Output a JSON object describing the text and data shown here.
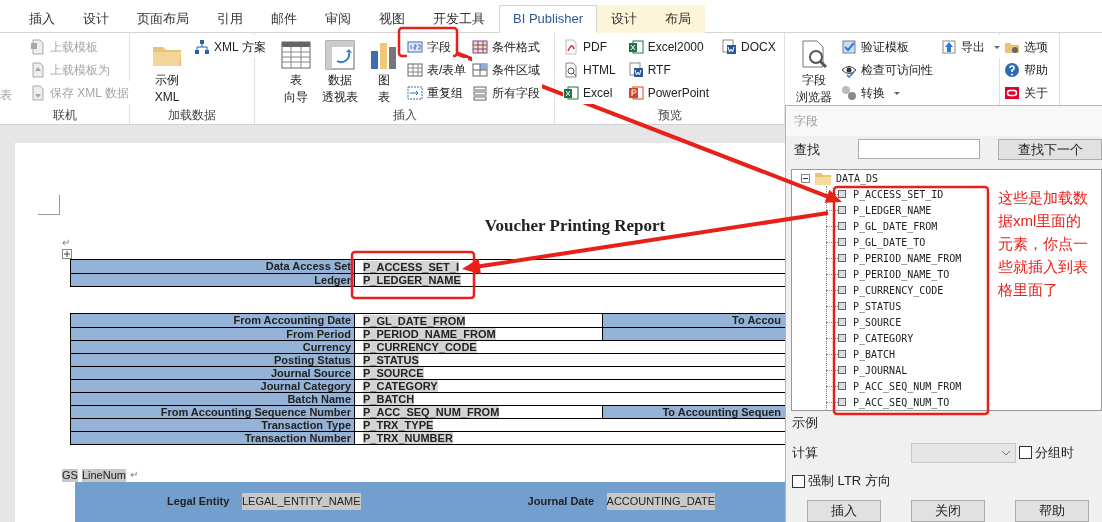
{
  "tabs": [
    {
      "label": "插入",
      "selected": false,
      "kind": "normal"
    },
    {
      "label": "设计",
      "selected": false,
      "kind": "normal"
    },
    {
      "label": "页面布局",
      "selected": false,
      "kind": "normal"
    },
    {
      "label": "引用",
      "selected": false,
      "kind": "normal"
    },
    {
      "label": "邮件",
      "selected": false,
      "kind": "normal"
    },
    {
      "label": "审阅",
      "selected": false,
      "kind": "normal"
    },
    {
      "label": "视图",
      "selected": false,
      "kind": "normal"
    },
    {
      "label": "开发工具",
      "selected": false,
      "kind": "normal"
    },
    {
      "label": "BI Publisher",
      "selected": true,
      "kind": "normal"
    },
    {
      "label": "设计",
      "selected": false,
      "kind": "contextual"
    },
    {
      "label": "布局",
      "selected": false,
      "kind": "contextual"
    }
  ],
  "ribbon": [
    {
      "label": "联机",
      "columns": [
        {
          "kind": "stack",
          "items": [
            {
              "label": "表",
              "disabled": true
            }
          ]
        },
        {
          "kind": "stack",
          "items": [
            {
              "label": "上载模板",
              "disabled": true
            },
            {
              "label": "上载模板为",
              "disabled": true
            },
            {
              "label": "保存 XML 数据",
              "disabled": true
            }
          ]
        }
      ]
    },
    {
      "label": "加载数据",
      "columns": [
        {
          "kind": "large",
          "items": [
            {
              "lines": [
                "示例",
                "XML"
              ],
              "disabled": false
            }
          ]
        },
        {
          "kind": "stack",
          "items": [
            {
              "label": "XML 方案",
              "disabled": false
            }
          ]
        }
      ]
    },
    {
      "label": "插入",
      "columns": [
        {
          "kind": "large",
          "items": [
            {
              "lines": [
                "表",
                "向导"
              ],
              "disabled": false
            }
          ]
        },
        {
          "kind": "large",
          "items": [
            {
              "lines": [
                "数据",
                "透视表"
              ],
              "disabled": false
            }
          ]
        },
        {
          "kind": "large",
          "items": [
            {
              "lines": [
                "图",
                "表"
              ],
              "disabled": false
            }
          ]
        },
        {
          "kind": "stack",
          "items": [
            {
              "label": "字段",
              "disabled": false
            },
            {
              "label": "表/表单",
              "disabled": false
            },
            {
              "label": "重复组",
              "disabled": false
            }
          ]
        },
        {
          "kind": "stack",
          "items": [
            {
              "label": "条件格式",
              "disabled": false
            },
            {
              "label": "条件区域",
              "disabled": false
            },
            {
              "label": "所有字段",
              "disabled": false
            }
          ]
        }
      ]
    },
    {
      "label": "预览",
      "columns": [
        {
          "kind": "stack",
          "items": [
            {
              "label": "PDF",
              "disabled": false
            },
            {
              "label": "HTML",
              "disabled": false
            },
            {
              "label": "Excel",
              "disabled": false
            }
          ]
        },
        {
          "kind": "stack",
          "items": [
            {
              "label": "Excel2000",
              "disabled": false
            },
            {
              "label": "RTF",
              "disabled": false
            },
            {
              "label": "PowerPoint",
              "disabled": false
            }
          ]
        },
        {
          "kind": "stack",
          "items": [
            {
              "label": "DOCX",
              "disabled": false
            }
          ]
        }
      ]
    },
    {
      "columns": [
        {
          "kind": "large",
          "items": [
            {
              "lines": [
                "字段",
                "浏览器"
              ],
              "disabled": false
            }
          ]
        },
        {
          "kind": "stack",
          "items": [
            {
              "label": "验证模板",
              "disabled": false
            },
            {
              "label": "检查可访问性",
              "disabled": false
            },
            {
              "label": "转换",
              "disabled": false,
              "dropdown": true
            }
          ]
        },
        {
          "kind": "stack",
          "items": [
            {
              "label": "导出",
              "disabled": false,
              "dropdown": true
            }
          ]
        }
      ]
    },
    {
      "columns": [
        {
          "kind": "stack",
          "items": [
            {
              "label": "选项",
              "disabled": false
            },
            {
              "label": "帮助",
              "disabled": false
            },
            {
              "label": "关于",
              "disabled": false
            }
          ]
        }
      ]
    }
  ],
  "document": {
    "title": "Voucher Printing Report",
    "title_mark": "↵",
    "header_table": [
      {
        "label": "Data Access Set",
        "value": "P_ACCESS_SET_I"
      },
      {
        "label": "Ledger",
        "value": "P_LEDGER_NAME"
      }
    ],
    "params_table": [
      {
        "label": "From Accounting Date",
        "value": "P_GL_DATE_FROM",
        "kind": "split",
        "column_3": "To Accou"
      },
      {
        "label": "From Period",
        "value": "P_PERIOD_NAME_FROM",
        "kind": "split"
      },
      {
        "label": "Currency",
        "value": "P_CURRENCY_CODE",
        "kind": "full"
      },
      {
        "label": "Posting Status",
        "value": "P_STATUS",
        "kind": "full"
      },
      {
        "label": "Journal Source",
        "value": "P_SOURCE",
        "kind": "full"
      },
      {
        "label": "Journal Category",
        "value": "P_CATEGORY",
        "kind": "full"
      },
      {
        "label": "Batch Name",
        "value": "P_BATCH",
        "kind": "full"
      },
      {
        "label": "From Accounting Sequence Number",
        "value": "P_ACC_SEQ_NUM_FROM",
        "kind": "split",
        "column_3": "To Accounting Sequen"
      },
      {
        "label": "Transaction Type",
        "value": "P_TRX_TYPE",
        "kind": "full"
      },
      {
        "label": "Transaction Number",
        "value": "P_TRX_NUMBER",
        "kind": "full"
      }
    ],
    "group_line": {
      "tags": [
        "GS",
        "LineNum"
      ],
      "mark": "↵"
    },
    "band": {
      "fields": [
        {
          "label": "Legal Entity",
          "value": "LEGAL_ENTITY_NAME"
        },
        {
          "label": "Journal Date",
          "value": "ACCOUNTING_DATE"
        }
      ]
    }
  },
  "field_dialog": {
    "title": "字段",
    "find_label": "查找",
    "find_button": "查找下一个",
    "tree": {
      "label": "DATA_DS",
      "expanded": true,
      "children": [
        {
          "label": "P_ACCESS_SET_ID"
        },
        {
          "label": "P_LEDGER_NAME"
        },
        {
          "label": "P_GL_DATE_FROM"
        },
        {
          "label": "P_GL_DATE_TO"
        },
        {
          "label": "P_PERIOD_NAME_FROM"
        },
        {
          "label": "P_PERIOD_NAME_TO"
        },
        {
          "label": "P_CURRENCY_CODE"
        },
        {
          "label": "P_STATUS"
        },
        {
          "label": "P_SOURCE"
        },
        {
          "label": "P_CATEGORY"
        },
        {
          "label": "P_BATCH"
        },
        {
          "label": "P_JOURNAL"
        },
        {
          "label": "P_ACC_SEQ_NUM_FROM"
        },
        {
          "label": "P_ACC_SEQ_NUM_TO"
        }
      ]
    },
    "example_label": "示例",
    "calc_label": "计算",
    "calc_select": {
      "disabled": true
    },
    "group_option": {
      "label": "分组时",
      "checked": false
    },
    "ltr_option": {
      "label": "强制 LTR 方向",
      "checked": false
    },
    "buttons": [
      "插入",
      "关闭",
      "帮助"
    ]
  },
  "annotation": {
    "note": "这些是加载数据xml里面的元素，你点一些就插入到表格里面了"
  }
}
